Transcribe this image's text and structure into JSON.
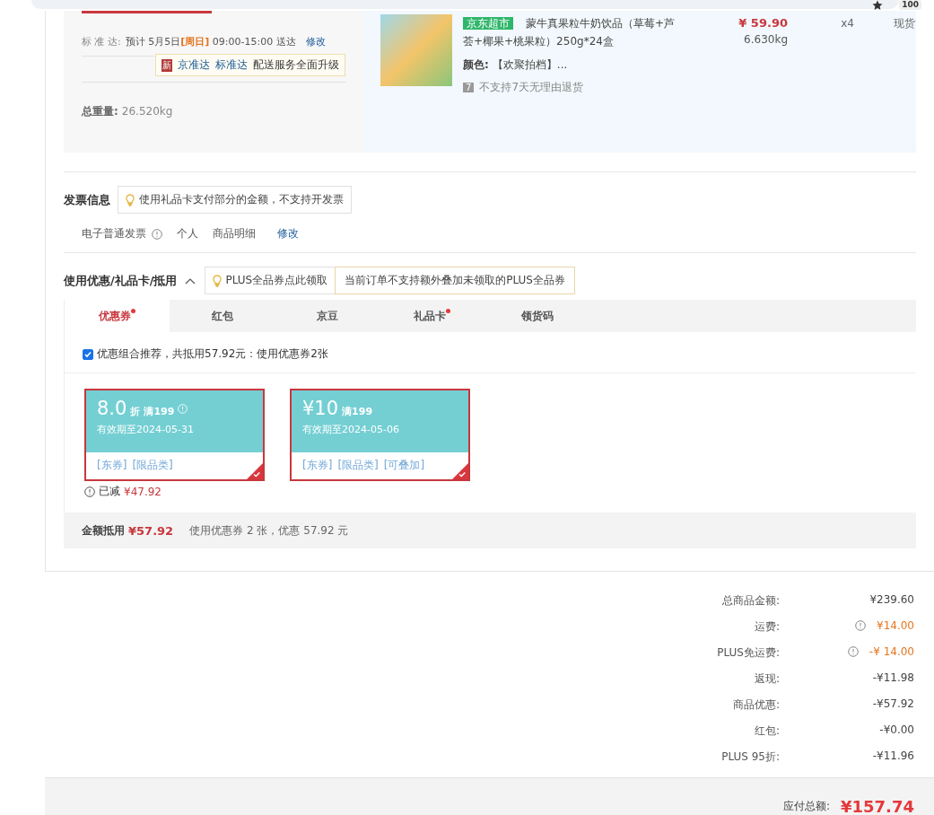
{
  "browser": {
    "badge": "100"
  },
  "delivery": {
    "label": "标 准 达:",
    "estimate": "预计 5月5日",
    "weekday": "[周日]",
    "time": "09:00-15:00 送达",
    "edit": "修改",
    "promo": {
      "new_tag": "新",
      "links": [
        "京准达",
        "标准达"
      ],
      "text": "配送服务全面升级"
    },
    "weight_label": "总重量:",
    "weight": "26.520kg"
  },
  "product": {
    "store_tag": "京东超市",
    "name": "蒙牛真果粒牛奶饮品（草莓+芦荟+椰果+桃果粒）250g*24盒",
    "attr_label": "颜色:",
    "attr_value": "【欢聚拍档】...",
    "return_badge": "7",
    "return_text": "不支持7天无理由退货",
    "price": "¥ 59.90",
    "weight": "6.630kg",
    "quantity": "x4",
    "stock": "现货"
  },
  "invoice": {
    "title": "发票信息",
    "tip": "使用礼品卡支付部分的金额，不支持开发票",
    "type": "电子普通发票",
    "holder": "个人",
    "content": "商品明细",
    "edit": "修改"
  },
  "discounts": {
    "title": "使用优惠/礼品卡/抵用",
    "expanded": true,
    "plus_tip": "PLUS全品券点此领取",
    "plus_note": "当前订单不支持额外叠加未领取的PLUS全品券",
    "tabs": [
      {
        "label": "优惠券",
        "selected": true,
        "dot": true
      },
      {
        "label": "红包",
        "selected": false,
        "dot": false
      },
      {
        "label": "京豆",
        "selected": false,
        "dot": false
      },
      {
        "label": "礼品卡",
        "selected": false,
        "dot": true
      },
      {
        "label": "领货码",
        "selected": false,
        "dot": false
      }
    ],
    "recommend": {
      "checked": true,
      "text": "优惠组合推荐，共抵用57.92元：使用优惠券2张"
    },
    "coupons": [
      {
        "amount": "8.0",
        "unit": "折",
        "threshold": "满199",
        "info": true,
        "validity": "有效期至2024-05-31",
        "tags": [
          "[东券]",
          "[限品类]"
        ],
        "selected": true
      },
      {
        "amount": "¥10",
        "threshold": "满199",
        "info": false,
        "validity": "有效期至2024-05-06",
        "tags": [
          "[东券]",
          "[限品类]",
          "[可叠加]"
        ],
        "selected": true
      }
    ],
    "deducted_label": "已减",
    "deducted": "¥47.92",
    "summary_label": "金额抵用",
    "summary_amount": "¥57.92",
    "summary_text": "使用优惠券 2 张，优惠 57.92 元"
  },
  "totals": {
    "rows": [
      {
        "label": "总商品金额:",
        "value": "¥239.60",
        "info": false,
        "highlight": false
      },
      {
        "label": "运费:",
        "value": "¥14.00",
        "info": true,
        "highlight": true
      },
      {
        "label": "PLUS免运费:",
        "value": "-¥ 14.00",
        "info": true,
        "highlight": true
      },
      {
        "label": "返现:",
        "value": "-¥11.98",
        "info": false,
        "highlight": false
      },
      {
        "label": "商品优惠:",
        "value": "-¥57.92",
        "info": false,
        "highlight": false
      },
      {
        "label": "红包:",
        "value": "-¥0.00",
        "info": false,
        "highlight": false
      },
      {
        "label": "PLUS 95折:",
        "value": "-¥11.96",
        "info": false,
        "highlight": false
      }
    ],
    "payable_label": "应付总额:",
    "payable": "¥157.74"
  }
}
